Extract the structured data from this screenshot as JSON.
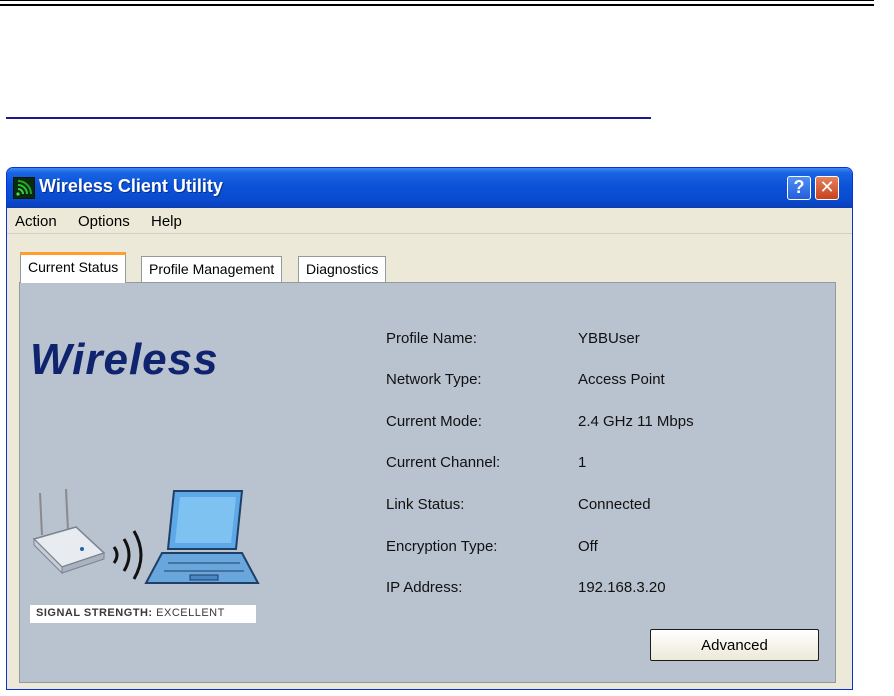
{
  "window": {
    "title": "Wireless Client Utility",
    "help_button": "?",
    "close_button": "✕"
  },
  "menu": {
    "items": [
      "Action",
      "Options",
      "Help"
    ]
  },
  "tabs": [
    {
      "label": "Current Status",
      "active": true
    },
    {
      "label": "Profile Management",
      "active": false
    },
    {
      "label": "Diagnostics",
      "active": false
    }
  ],
  "status_panel": {
    "logo_text": "Wireless",
    "signal_strength_label": "SIGNAL STRENGTH:",
    "signal_strength_value": "EXCELLENT",
    "fields": [
      {
        "label": "Profile Name:",
        "value": "YBBUser"
      },
      {
        "label": "Network Type:",
        "value": "Access Point"
      },
      {
        "label": "Current Mode:",
        "value": "2.4 GHz 11 Mbps"
      },
      {
        "label": "Current Channel:",
        "value": "1"
      },
      {
        "label": "Link Status:",
        "value": "Connected"
      },
      {
        "label": "Encryption Type:",
        "value": "Off"
      },
      {
        "label": "IP Address:",
        "value": "192.168.3.20"
      }
    ],
    "advanced_button": "Advanced"
  },
  "icons": {
    "app": "wireless-signal-icon",
    "graphic": [
      "access-point-icon",
      "signal-waves-icon",
      "laptop-icon"
    ]
  },
  "colors": {
    "titlebar": "#0a52d8",
    "panel_background": "#b9c2cf",
    "logo_text": "#0f236f",
    "active_tab_accent": "#ff9e2c"
  }
}
